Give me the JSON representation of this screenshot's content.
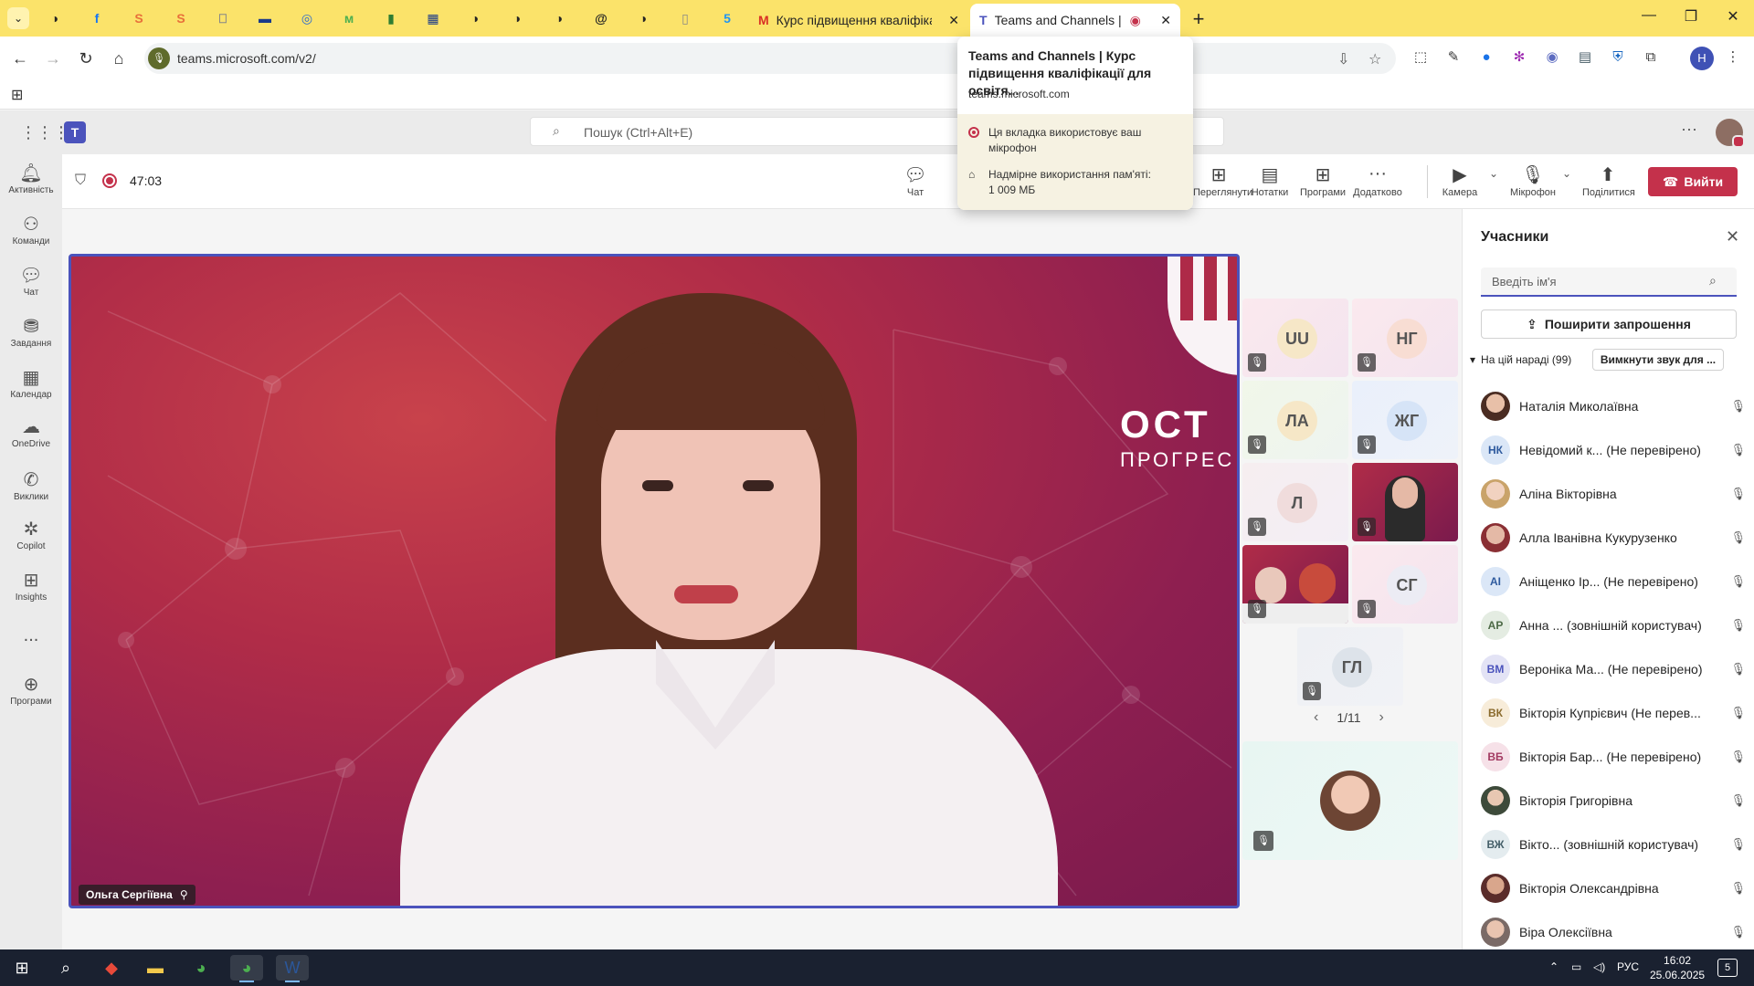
{
  "browser": {
    "tabs": [
      {
        "title": "Курс підвищення кваліфікації",
        "icon": "gmail-icon"
      },
      {
        "title": "Teams and Channels | Курс",
        "icon": "teams-icon"
      }
    ],
    "url": "teams.microsoft.com/v2/",
    "profile_initial": "Н",
    "new_tab": "+",
    "hovercard": {
      "title": "Teams and Channels | Курс підвищення кваліфікації для освітя...",
      "url": "teams.microsoft.com",
      "mic_notice": "Ця вкладка використовує ваш мікрофон",
      "memory_label": "Надмірне використання пам'яті:",
      "memory_value": "1 009 МБ"
    }
  },
  "teams": {
    "search_placeholder": "Пошук (Ctrl+Alt+E)",
    "rail": [
      {
        "label": "Активність",
        "icon": "bell-icon"
      },
      {
        "label": "Команди",
        "icon": "teams-group-icon"
      },
      {
        "label": "Чат",
        "icon": "chat-icon"
      },
      {
        "label": "Завдання",
        "icon": "assignments-icon"
      },
      {
        "label": "Календар",
        "icon": "calendar-icon"
      },
      {
        "label": "OneDrive",
        "icon": "cloud-icon"
      },
      {
        "label": "Виклики",
        "icon": "phone-icon"
      },
      {
        "label": "Copilot",
        "icon": "copilot-icon"
      },
      {
        "label": "Insights",
        "icon": "insights-icon"
      },
      {
        "label": "...",
        "icon": "more-icon"
      },
      {
        "label": "Програми",
        "icon": "apps-icon"
      }
    ]
  },
  "meeting": {
    "timer": "47:03",
    "toolbar": {
      "chat": "Чат",
      "view": "Переглянути",
      "notes": "Нотатки",
      "apps": "Програми",
      "more": "Додатково",
      "camera": "Камера",
      "mic": "Мікрофон",
      "share": "Поділитися",
      "leave": "Вийти"
    },
    "speaker_name": "Ольга Сергіївна",
    "background_brand": "ОСТ",
    "background_brand_sub": "ПРОГРЕС",
    "tiles": [
      {
        "initials": "UU"
      },
      {
        "initials": "НГ"
      },
      {
        "initials": "ЛА"
      },
      {
        "initials": "ЖГ"
      },
      {
        "initials": "Л"
      },
      {
        "initials": ""
      },
      {
        "initials": ""
      },
      {
        "initials": "СГ"
      },
      {
        "initials": "ГЛ"
      }
    ],
    "pager": "1/11"
  },
  "participants": {
    "title": "Учасники",
    "search_placeholder": "Введіть ім'я",
    "invite_label": "Поширити запрошення",
    "section_label": "На цій нараді (99)",
    "mute_all_label": "Вимкнути звук для ...",
    "list": [
      {
        "initials": "",
        "name": "Наталія Миколаївна"
      },
      {
        "initials": "НК",
        "name": "Невідомий к... (Не перевірено)"
      },
      {
        "initials": "",
        "name": "Аліна Вікторівна"
      },
      {
        "initials": "",
        "name": "Алла Іванівна Кукурузенко"
      },
      {
        "initials": "AI",
        "name": "Аніщенко Ір... (Не перевірено)"
      },
      {
        "initials": "АР",
        "name": "Анна ... (зовнішній користувач)"
      },
      {
        "initials": "ВМ",
        "name": "Вероніка Ма... (Не перевірено)"
      },
      {
        "initials": "ВК",
        "name": "Вікторія Купрієвич (Не перев..."
      },
      {
        "initials": "ВБ",
        "name": "Вікторія Бар... (Не перевірено)"
      },
      {
        "initials": "",
        "name": "Вікторія Григорівна"
      },
      {
        "initials": "ВЖ",
        "name": "Вікто... (зовнішній користувач)"
      },
      {
        "initials": "",
        "name": "Вікторія Олександрівна"
      },
      {
        "initials": "",
        "name": "Віра Олексіївна"
      }
    ]
  },
  "taskbar": {
    "language": "РУС",
    "time": "16:02",
    "date": "25.06.2025",
    "notifications": "5"
  }
}
